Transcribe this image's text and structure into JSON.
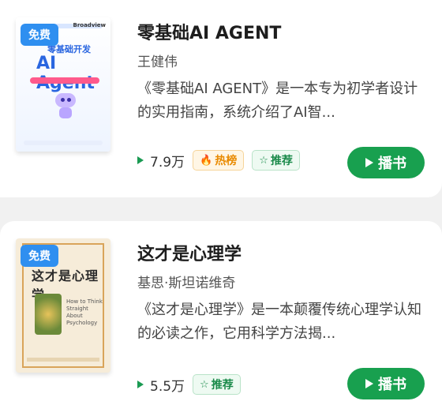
{
  "books": [
    {
      "badge": "免费",
      "title": "零基础AI AGENT",
      "author": "王健伟",
      "description": "《零基础AI AGENT》是一本专为初学者设计的实用指南，系统介绍了AI智...",
      "plays": "7.9万",
      "tags": {
        "hot": "热榜",
        "recommend": "推荐"
      },
      "listen_label": "播书",
      "cover": {
        "subtitle": "零基础开发",
        "main": "AI Agent",
        "brand": "Broadview"
      }
    },
    {
      "badge": "免费",
      "title": "这才是心理学",
      "author": "基思·斯坦诺维奇",
      "description": "《这才是心理学》是一本颠覆传统心理学认知的必读之作，它用科学方法揭...",
      "plays": "5.5万",
      "tags": {
        "recommend": "推荐"
      },
      "listen_label": "播书",
      "cover": {
        "main": "这才是心理学",
        "english": "How to Think Straight About Psychology"
      }
    }
  ],
  "colors": {
    "accent": "#18a04f",
    "badge": "#2f8ff0",
    "hot": "#e98a00"
  }
}
